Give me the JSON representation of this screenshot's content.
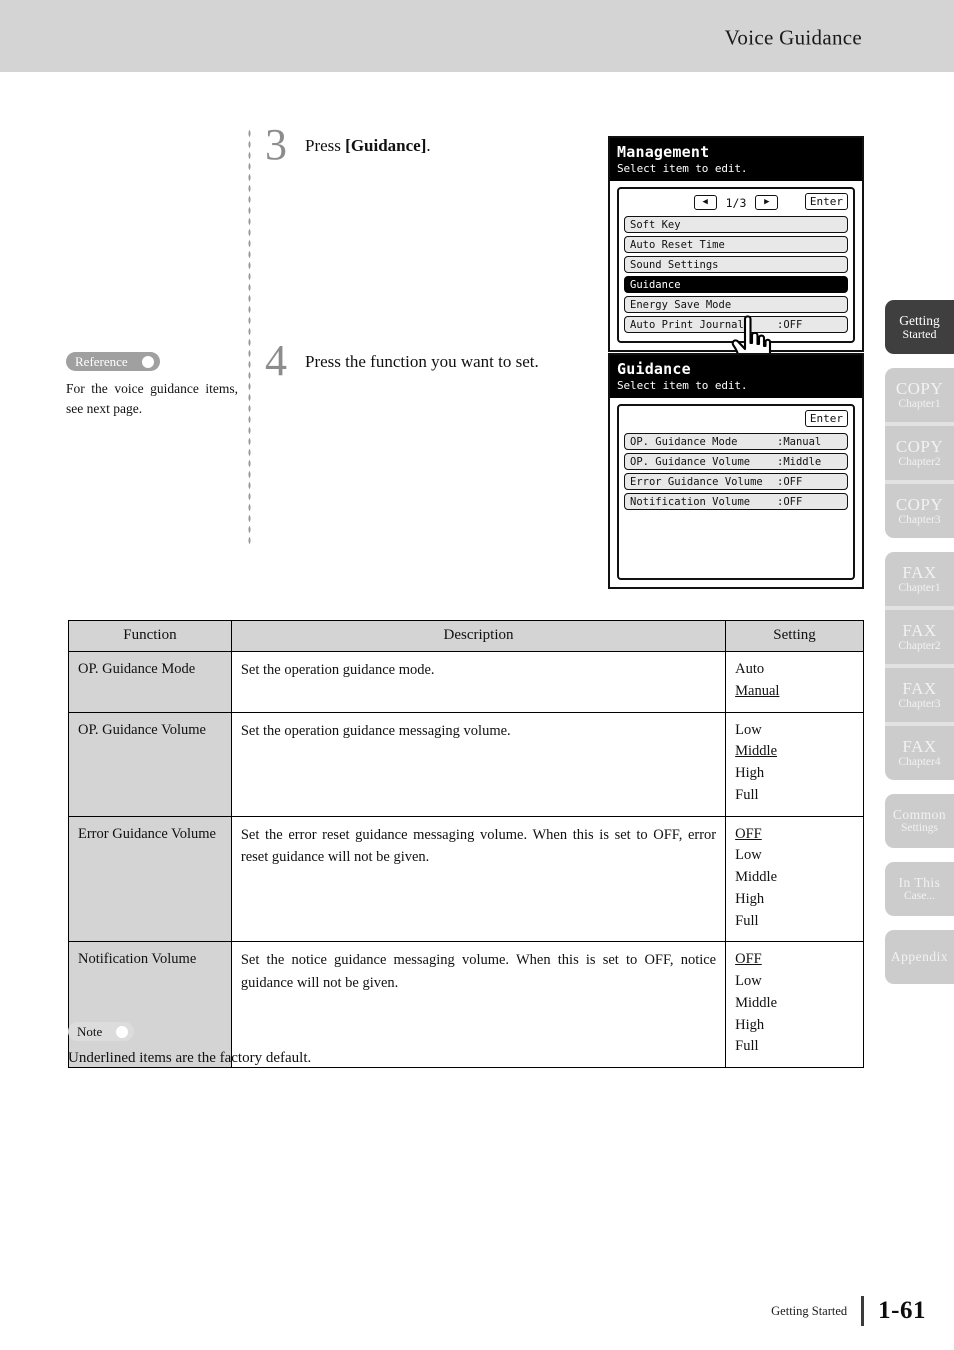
{
  "header": {
    "title": "Voice Guidance"
  },
  "steps": [
    {
      "number": "3",
      "text_plain": "Press [Guidance]."
    },
    {
      "number": "4",
      "text_plain": "Press the function you want to set."
    }
  ],
  "reference": {
    "badge_label": "Reference",
    "body": "For the voice guidance items, see next page."
  },
  "note": {
    "badge_label": "Note",
    "body": "Underlined items are the factory default."
  },
  "lcd_management": {
    "title": "Management",
    "subtitle": "Select item to edit.",
    "prev_label": "◀",
    "next_label": "▶",
    "page_indicator": "1/3",
    "enter_label": "Enter",
    "rows": [
      {
        "label": "Soft Key",
        "value": "",
        "selected": false
      },
      {
        "label": "Auto Reset Time",
        "value": "",
        "selected": false
      },
      {
        "label": "Sound Settings",
        "value": "",
        "selected": false
      },
      {
        "label": "Guidance",
        "value": "",
        "selected": true
      },
      {
        "label": "Energy Save Mode",
        "value": "",
        "selected": false
      },
      {
        "label": "Auto Print Journal",
        "value": ":OFF",
        "selected": false
      }
    ]
  },
  "lcd_guidance": {
    "title": "Guidance",
    "subtitle": "Select item to edit.",
    "enter_label": "Enter",
    "rows": [
      {
        "label": "OP. Guidance Mode",
        "value": ":Manual",
        "selected": false
      },
      {
        "label": "OP. Guidance Volume",
        "value": ":Middle",
        "selected": false
      },
      {
        "label": "Error Guidance Volume",
        "value": ":OFF",
        "selected": false
      },
      {
        "label": "Notification Volume",
        "value": ":OFF",
        "selected": false
      }
    ]
  },
  "table": {
    "headers": [
      "Function",
      "Description",
      "Setting"
    ],
    "rows": [
      {
        "function": "OP. Guidance Mode",
        "description": "Set the operation guidance mode.",
        "settings": [
          {
            "label": "Auto",
            "default": false
          },
          {
            "label": "Manual",
            "default": true
          }
        ]
      },
      {
        "function": "OP. Guidance Volume",
        "description": "Set the operation guidance messaging volume.",
        "settings": [
          {
            "label": "Low",
            "default": false
          },
          {
            "label": "Middle",
            "default": true
          },
          {
            "label": "High",
            "default": false
          },
          {
            "label": "Full",
            "default": false
          }
        ]
      },
      {
        "function": "Error Guidance Volume",
        "description": "Set the error reset guidance messaging volume. When this is set to OFF, error reset guidance will not be given.",
        "settings": [
          {
            "label": "OFF",
            "default": true
          },
          {
            "label": "Low",
            "default": false
          },
          {
            "label": "Middle",
            "default": false
          },
          {
            "label": "High",
            "default": false
          },
          {
            "label": "Full",
            "default": false
          }
        ]
      },
      {
        "function": "Notification Volume",
        "description": "Set the notice guidance messaging volume. When this is set to OFF, notice guidance will not be given.",
        "settings": [
          {
            "label": "OFF",
            "default": true
          },
          {
            "label": "Low",
            "default": false
          },
          {
            "label": "Middle",
            "default": false
          },
          {
            "label": "High",
            "default": false
          },
          {
            "label": "Full",
            "default": false
          }
        ]
      }
    ]
  },
  "tabs": {
    "groups": [
      {
        "items": [
          {
            "main": "Getting",
            "sub": "Started",
            "active": true,
            "two_line": true
          }
        ]
      },
      {
        "items": [
          {
            "main": "COPY",
            "sub": "Chapter1",
            "active": false
          },
          {
            "main": "COPY",
            "sub": "Chapter2",
            "active": false
          },
          {
            "main": "COPY",
            "sub": "Chapter3",
            "active": false
          }
        ]
      },
      {
        "items": [
          {
            "main": "FAX",
            "sub": "Chapter1",
            "active": false
          },
          {
            "main": "FAX",
            "sub": "Chapter2",
            "active": false
          },
          {
            "main": "FAX",
            "sub": "Chapter3",
            "active": false
          },
          {
            "main": "FAX",
            "sub": "Chapter4",
            "active": false
          }
        ]
      },
      {
        "items": [
          {
            "main": "Common",
            "sub": "Settings",
            "active": false,
            "two_line": true
          }
        ]
      },
      {
        "items": [
          {
            "main": "In This",
            "sub": "Case...",
            "active": false,
            "two_line": true
          }
        ]
      },
      {
        "items": [
          {
            "main": "Appendix",
            "sub": "",
            "active": false,
            "two_line": true
          }
        ]
      }
    ]
  },
  "footer": {
    "label": "Getting Started",
    "page": "1-61"
  }
}
